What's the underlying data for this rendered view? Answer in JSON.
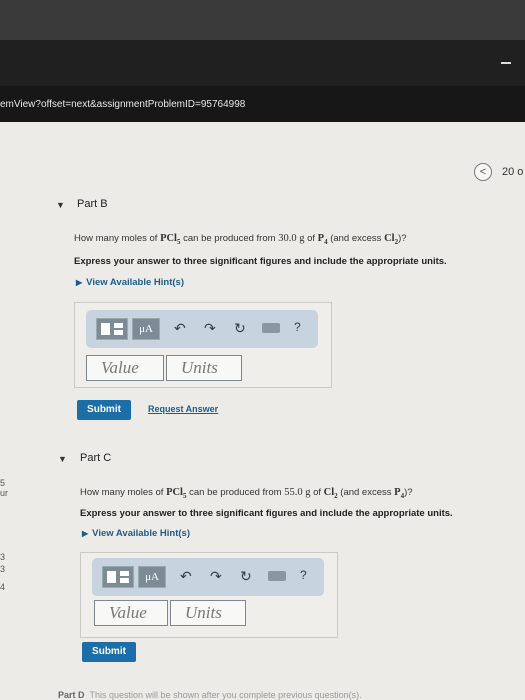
{
  "browser": {
    "url": "emView?offset=next&assignmentProblemID=95764998"
  },
  "nav": {
    "prev_icon": "chevron-left-icon",
    "prev_glyph": "<",
    "count": "20 o"
  },
  "left_strip": [
    "5",
    "ur",
    "3",
    "3",
    "4"
  ],
  "part_b": {
    "toggle": "▼",
    "title": "Part B",
    "question_pre": "How many moles of ",
    "formula1": "PCl",
    "formula1_sub": "5",
    "question_mid1": " can be produced from ",
    "mass": "30.0 g",
    "question_mid2": " of ",
    "formula2": "P",
    "formula2_sub": "4",
    "question_mid3": " (and excess ",
    "formula3": "Cl",
    "formula3_sub": "2",
    "question_end": ")?",
    "instruction": "Express your answer to three significant figures and include the appropriate units.",
    "hint": "View Available Hint(s)",
    "value_placeholder": "Value",
    "units_placeholder": "Units",
    "submit": "Submit",
    "request_answer": "Request Answer"
  },
  "part_c": {
    "toggle": "▼",
    "title": "Part C",
    "question_pre": "How many moles of ",
    "formula1": "PCl",
    "formula1_sub": "5",
    "question_mid1": " can be produced from ",
    "mass": "55.0 g",
    "question_mid2": " of ",
    "formula2": "Cl",
    "formula2_sub": "2",
    "question_mid3": " (and excess ",
    "formula3": "P",
    "formula3_sub": "4",
    "question_end": ")?",
    "instruction": "Express your answer to three significant figures and include the appropriate units.",
    "hint": "View Available Hint(s)",
    "value_placeholder": "Value",
    "units_placeholder": "Units",
    "submit": "Submit"
  },
  "toolbar": {
    "mu_label": "μA",
    "undo_glyph": "↶",
    "redo_glyph": "↷",
    "reset_glyph": "↻",
    "help_glyph": "?"
  },
  "footer": {
    "label": "Part D",
    "text": "This question will be shown after you complete previous question(s)."
  },
  "colors": {
    "accent": "#1b6ea8",
    "link": "#1d5c8c",
    "toolbar_bg": "#c7d3de"
  }
}
